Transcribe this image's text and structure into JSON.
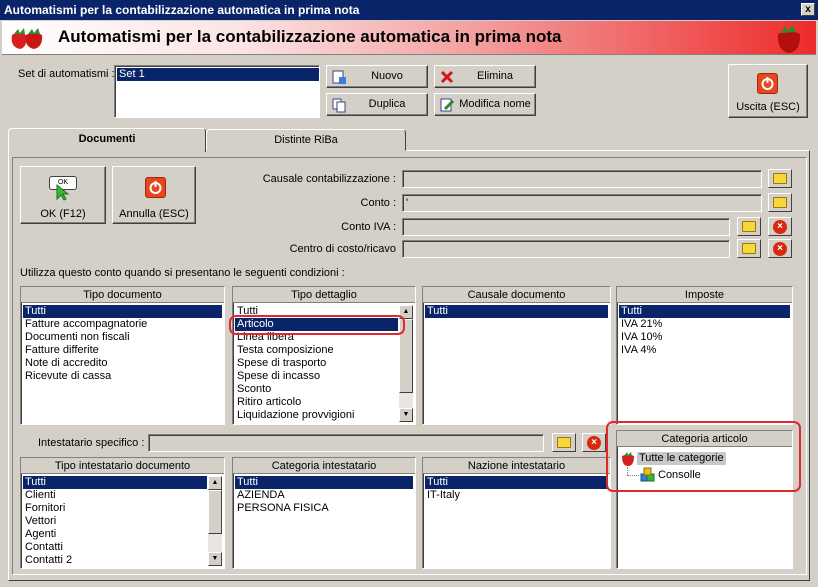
{
  "window": {
    "title": "Automatismi per la contabilizzazione automatica in prima nota",
    "close": "x"
  },
  "banner": {
    "title": "Automatismi per la contabilizzazione automatica in prima nota"
  },
  "set": {
    "label": "Set di automatismi :",
    "items": [
      "Set 1"
    ],
    "selected": 0,
    "buttons": {
      "new": "Nuovo",
      "delete": "Elimina",
      "duplicate": "Duplica",
      "rename": "Modifica nome"
    }
  },
  "exit_button": "Uscita (ESC)",
  "tabs": [
    {
      "label": "Documenti",
      "active": true
    },
    {
      "label": "Distinte RiBa",
      "active": false
    }
  ],
  "actions": {
    "ok": "OK (F12)",
    "ok_icon_text": "OK",
    "cancel": "Annulla (ESC)"
  },
  "fields": {
    "causale": {
      "label": "Causale contabilizzazione :",
      "value": ""
    },
    "conto": {
      "label": "Conto :",
      "value": "'"
    },
    "conto_iva": {
      "label": "Conto IVA :",
      "value": ""
    },
    "centro": {
      "label": "Centro di costo/ricavo",
      "value": ""
    }
  },
  "conditions_label": "Utilizza questo conto quando si presentano le seguenti condizioni :",
  "lists": {
    "tipo_documento": {
      "header": "Tipo documento",
      "items": [
        "Tutti",
        "Fatture accompagnatorie",
        "Documenti non fiscali",
        "Fatture differite",
        "Note di accredito",
        "Ricevute di cassa"
      ]
    },
    "tipo_dettaglio": {
      "header": "Tipo dettaglio",
      "items": [
        "Tutti",
        "Articolo",
        "Linea libera",
        "Testa composizione",
        "Spese di trasporto",
        "Spese di incasso",
        "Sconto",
        "Ritiro articolo",
        "Liquidazione provvigioni"
      ]
    },
    "causale_documento": {
      "header": "Causale documento",
      "items": [
        "Tutti"
      ]
    },
    "imposte": {
      "header": "Imposte",
      "items": [
        "Tutti",
        "IVA 21%",
        "IVA 10%",
        "IVA 4%"
      ]
    },
    "tipo_intestatario": {
      "header": "Tipo intestatario documento",
      "items": [
        "Tutti",
        "Clienti",
        "Fornitori",
        "Vettori",
        "Agenti",
        "Contatti",
        "Contatti 2"
      ]
    },
    "categoria_intestatario": {
      "header": "Categoria intestatario",
      "items": [
        "Tutti",
        "AZIENDA",
        "PERSONA FISICA"
      ]
    },
    "nazione_intestatario": {
      "header": "Nazione intestatario",
      "items": [
        "Tutti",
        "IT-Italy"
      ]
    }
  },
  "intestatario": {
    "label": "Intestatario specifico :",
    "value": ""
  },
  "categoria_articolo": {
    "header": "Categoria articolo",
    "root": "Tutte le categorie",
    "children": [
      "Consolle"
    ]
  },
  "colors": {
    "selection": "#0a246a",
    "titlebar": "#0a246a",
    "highlight": "#e0282e",
    "face": "#d4d0c8"
  }
}
